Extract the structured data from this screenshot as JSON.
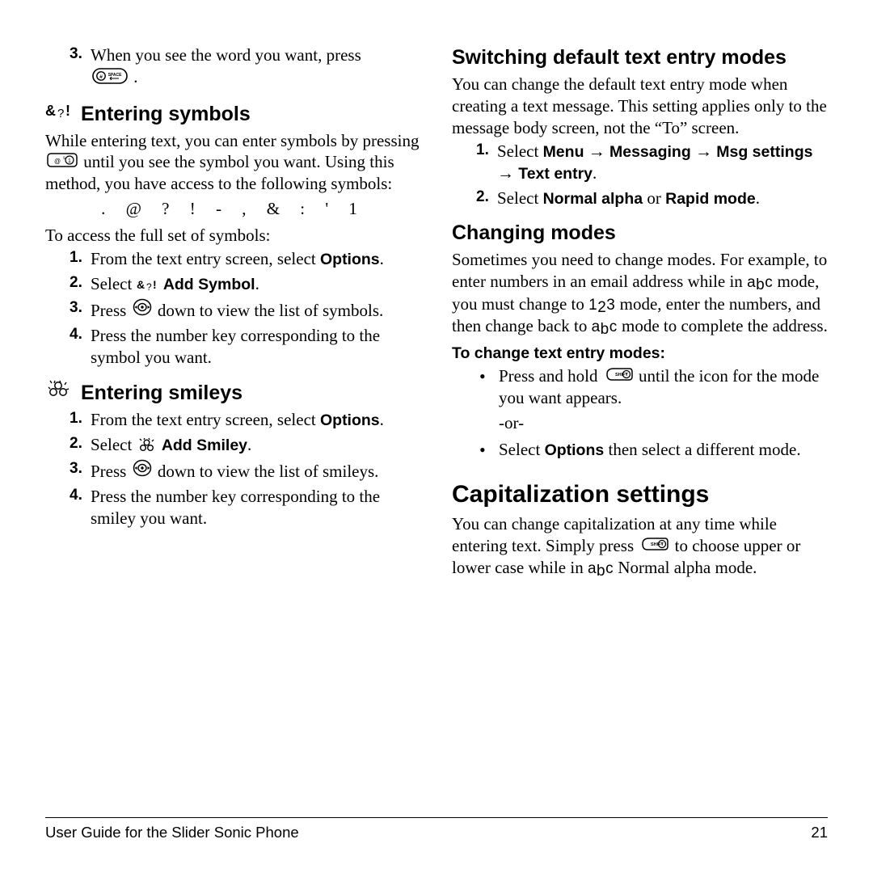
{
  "left": {
    "item3_prefix": "When you see the word you want, press",
    "item3_suffix": ".",
    "item3_num": "3.",
    "symbols_heading": "Entering symbols",
    "symbols_intro_a": "While entering text, you can enter symbols by pressing ",
    "symbols_intro_b": " until you see the symbol you want. Using this method, you have access to the following symbols:",
    "symbols_row": ". @ ? ! - , & : ' 1",
    "symbols_access": "To access the full set of symbols:",
    "sym_step1_num": "1.",
    "sym_step1_a": "From the text entry screen, select ",
    "sym_step1_b": "Options",
    "sym_step1_c": ".",
    "sym_step2_num": "2.",
    "sym_step2_a": "Select ",
    "sym_step2_glyph": "&?!",
    "sym_step2_b": " Add Symbol",
    "sym_step2_c": ".",
    "sym_step3_num": "3.",
    "sym_step3_a": "Press ",
    "sym_step3_b": " down to view the list of symbols.",
    "sym_step4_num": "4.",
    "sym_step4": "Press the number key corresponding to the symbol you want.",
    "smileys_heading": "Entering smileys",
    "smi_step1_num": "1.",
    "smi_step1_a": "From the text entry screen, select ",
    "smi_step1_b": "Options",
    "smi_step1_c": ".",
    "smi_step2_num": "2.",
    "smi_step2_a": "Select ",
    "smi_step2_b": " Add Smiley",
    "smi_step2_c": ".",
    "smi_step3_num": "3.",
    "smi_step3_a": "Press ",
    "smi_step3_b": " down to view the list of smileys.",
    "smi_step4_num": "4.",
    "smi_step4": "Press the number key corresponding to the smiley you want."
  },
  "right": {
    "switch_heading": "Switching default text entry modes",
    "switch_intro": "You can change the default text entry mode when creating a text message. This setting applies only to the message body screen, not the “To” screen.",
    "switch_step1_num": "1.",
    "switch_step1_a": "Select ",
    "switch_step1_b": "Menu",
    "switch_step1_arrow": " → ",
    "switch_step1_c": "Messaging",
    "switch_step1_d": "Msg settings",
    "switch_step1_e": "Text entry",
    "switch_step1_dot": ".",
    "switch_step2_num": "2.",
    "switch_step2_a": "Select ",
    "switch_step2_b": "Normal alpha",
    "switch_step2_or": " or ",
    "switch_step2_c": "Rapid mode",
    "switch_step2_dot": ".",
    "changing_heading": "Changing modes",
    "changing_body_a": "Sometimes you need to change modes. For example, to enter numbers in an email address while in ",
    "changing_abc": "abc",
    "changing_body_b": " mode, you must change to ",
    "changing_123": "123",
    "changing_body_c": " mode, enter the numbers, and then change back to ",
    "changing_body_d": " mode to complete the address.",
    "change_subheading": "To change text entry modes:",
    "change_bullet1_a": "Press and hold ",
    "change_bullet1_b": " until the icon for the mode you want appears.",
    "or_text": "-or-",
    "change_bullet2_a": "Select ",
    "change_bullet2_b": "Options",
    "change_bullet2_c": " then select a different mode.",
    "cap_heading": "Capitalization settings",
    "cap_body_a": "You can change capitalization at any time while entering text. Simply press ",
    "cap_body_b": " to choose upper or lower case while in ",
    "cap_body_c": " Normal alpha mode."
  },
  "footer": {
    "left": "User Guide for the Slider Sonic Phone",
    "right": "21"
  }
}
